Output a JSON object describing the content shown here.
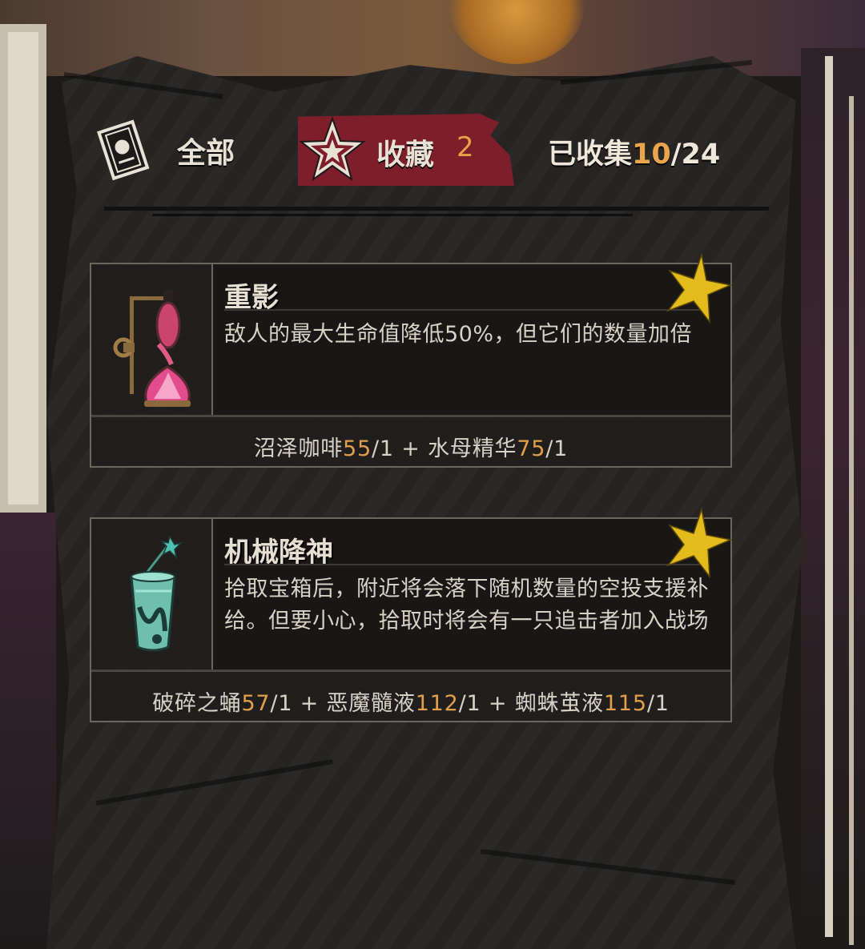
{
  "tabs": {
    "all": {
      "label": "全部",
      "icon": "card-icon"
    },
    "favorites": {
      "label": "收藏",
      "count": "2",
      "icon": "star-icon"
    }
  },
  "collection": {
    "label": "已收集",
    "collected": "10",
    "separator": "/",
    "total": "24"
  },
  "items": [
    {
      "name": "重影",
      "description": "敌人的最大生命值降低50%，但它们的数量加倍",
      "favorited": true,
      "icon": "pink-hourglass-flask-icon",
      "recipe": [
        {
          "ingredient": "沼泽咖啡",
          "level": "55",
          "qty": "/1"
        },
        {
          "ingredient": "水母精华",
          "level": "75",
          "qty": "/1"
        }
      ]
    },
    {
      "name": "机械降神",
      "description": "拾取宝箱后，附近将会落下随机数量的空投支援补给。但要小心，拾取时将会有一只追击者加入战场",
      "favorited": true,
      "icon": "green-cocktail-glass-icon",
      "recipe": [
        {
          "ingredient": "破碎之蛹",
          "level": "57",
          "qty": "/1"
        },
        {
          "ingredient": "恶魔髓液",
          "level": "112",
          "qty": "/1"
        },
        {
          "ingredient": "蜘蛛茧液",
          "level": "115",
          "qty": "/1"
        }
      ]
    }
  ],
  "recipe_joiner": " + ",
  "colors": {
    "accent_orange": "#e7a24a",
    "favorite_red": "#7e1e2a",
    "favorite_star": "#e4bb1c",
    "text_light": "#e6e0d2"
  }
}
